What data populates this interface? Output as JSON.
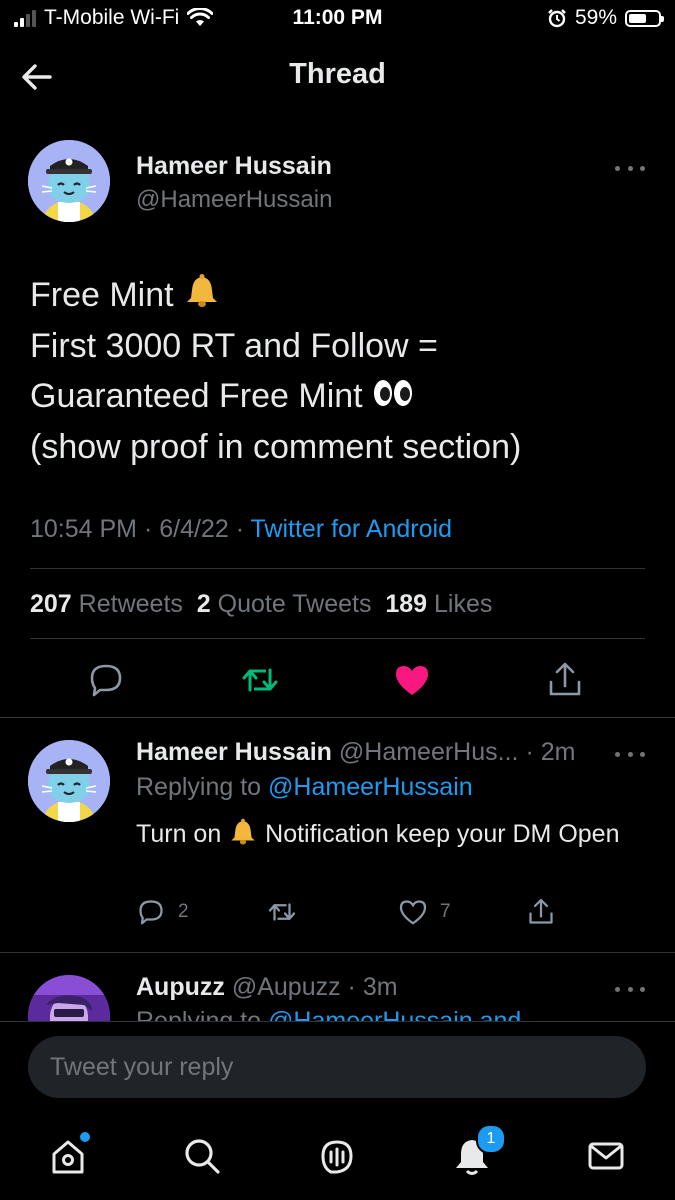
{
  "status_bar": {
    "carrier": "T-Mobile Wi-Fi",
    "time": "11:00 PM",
    "battery": "59%",
    "battery_level": 0.59,
    "icons": [
      "signal-bars-icon",
      "wifi-icon",
      "alarm-icon",
      "battery-icon"
    ]
  },
  "header": {
    "title": "Thread",
    "back_icon": "back-arrow-icon"
  },
  "main_tweet": {
    "author_name": "Hameer Hussain",
    "author_handle": "@HameerHussain",
    "lines": {
      "l1": "Free Mint",
      "l2": "First 3000 RT and Follow  =",
      "l3": "Guaranteed Free Mint",
      "l4": "(show proof in comment section)"
    },
    "emojis": [
      "bell-emoji",
      "eyes-emoji"
    ],
    "time": "10:54 PM",
    "date": "6/4/22",
    "source": "Twitter for Android",
    "stats": {
      "retweets": "207",
      "retweets_label": "Retweets",
      "quotes": "2",
      "quotes_label": "Quote Tweets",
      "likes": "189",
      "likes_label": "Likes"
    },
    "action_icons": [
      "reply-icon",
      "retweet-icon",
      "like-icon",
      "share-icon"
    ],
    "retweet_color": "#00ba7c",
    "like_color": "#f91880"
  },
  "reply_1": {
    "author_name": "Hameer Hussain",
    "author_handle": "@HameerHus...",
    "time": "· 2m",
    "replying_label": "Replying to",
    "replying_to": "@HameerHussain",
    "text_before": "Turn on",
    "text_after": "Notification keep your DM Open",
    "reply_count": "2",
    "retweet_count": "",
    "like_count": "7"
  },
  "reply_2": {
    "author_name": "Aupuzz",
    "author_handle": "@Aupuzz",
    "time": "· 3m",
    "replying_label": "Replying to",
    "replying_to": "@HameerHussain and"
  },
  "composer": {
    "placeholder": "Tweet your reply"
  },
  "bottom_nav": {
    "items": [
      "home-icon",
      "search-icon",
      "spaces-icon",
      "notifications-icon",
      "messages-icon"
    ],
    "notification_count": "1",
    "accent": "#1d9bf0"
  }
}
